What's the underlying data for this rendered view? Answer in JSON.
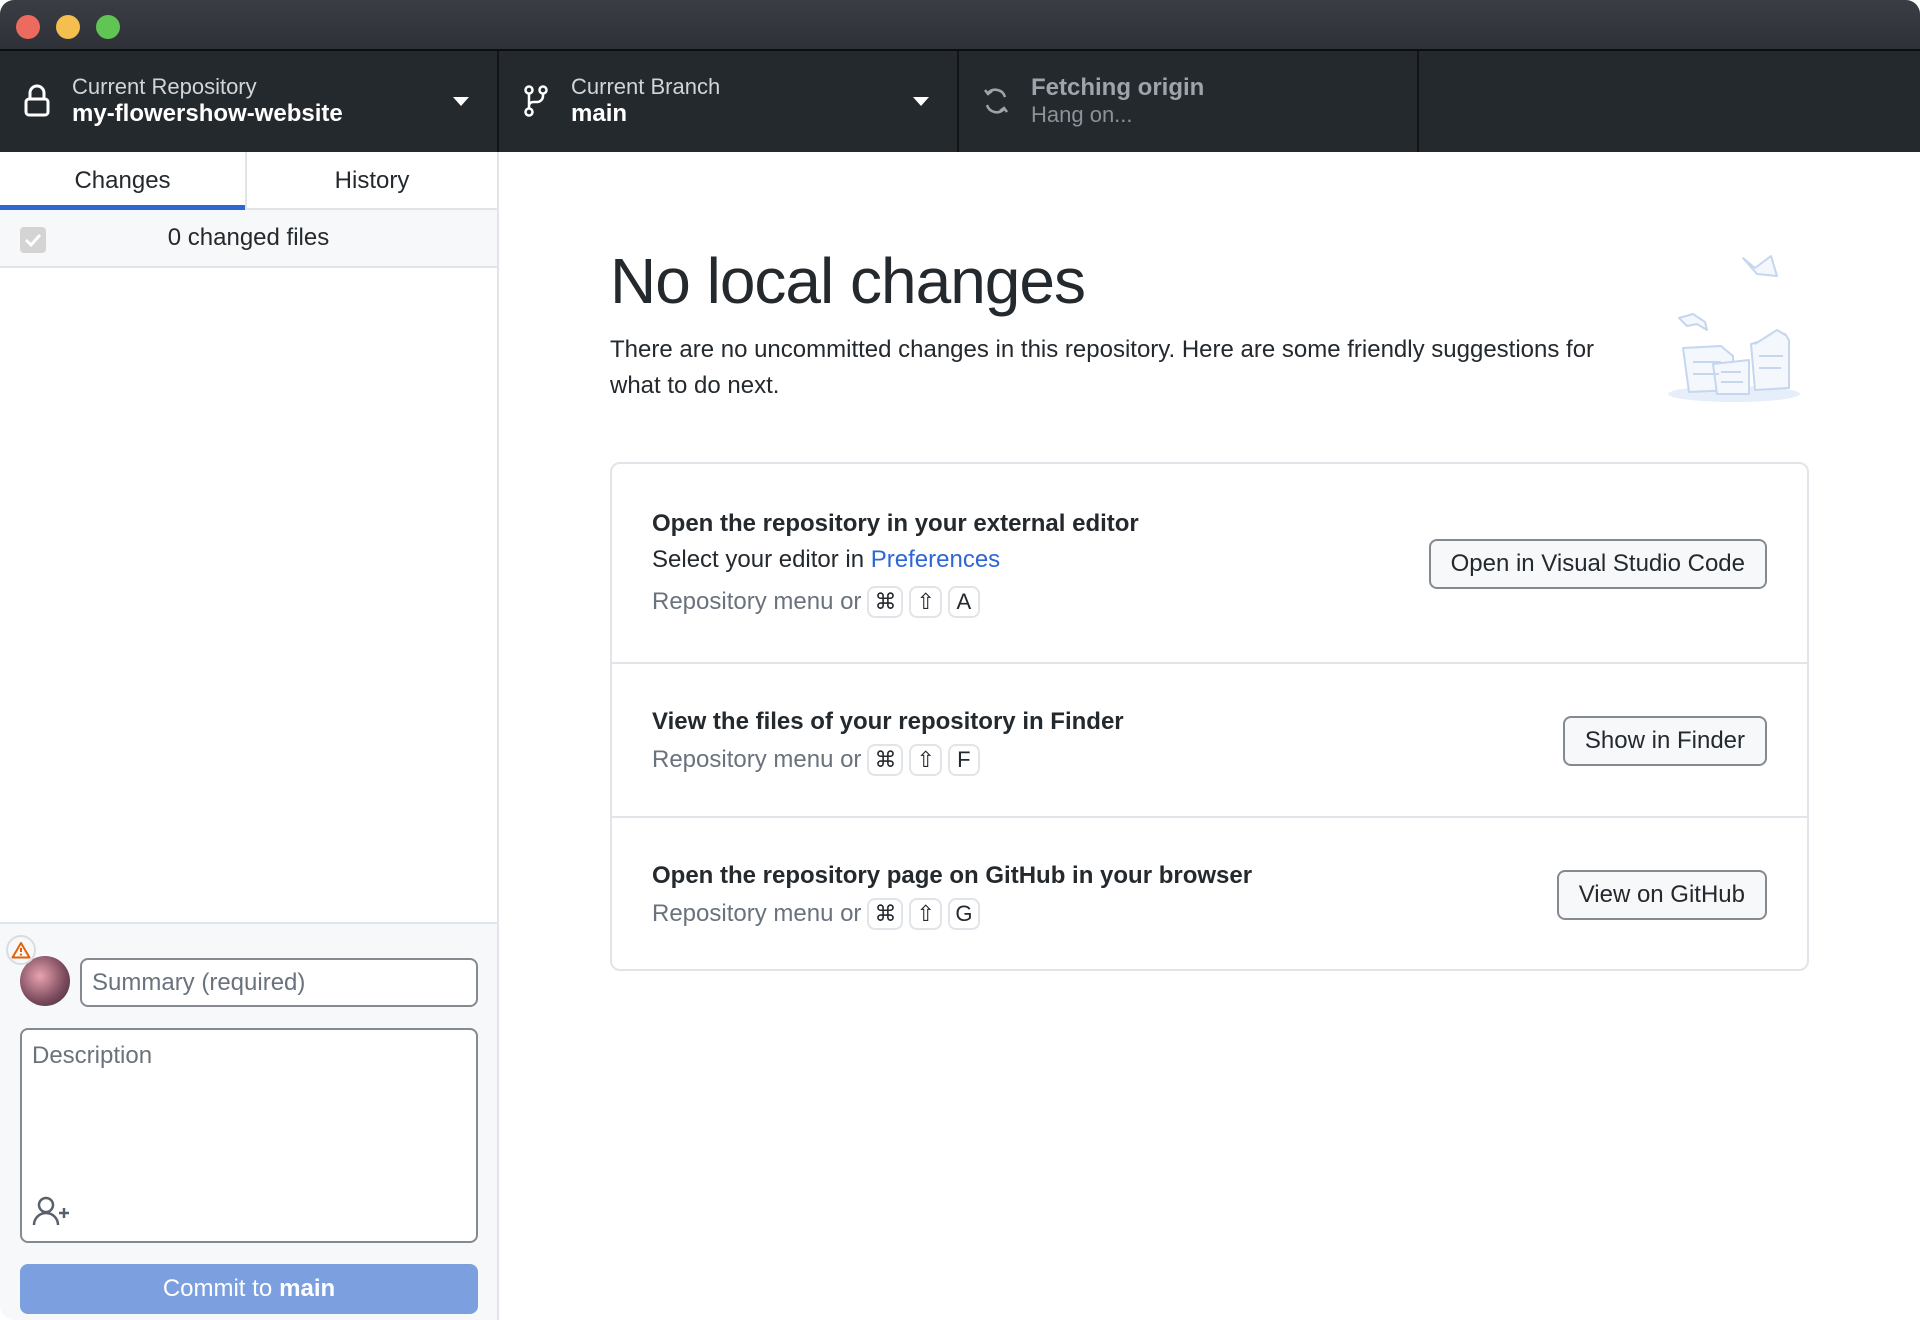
{
  "window": {
    "controls": [
      "close",
      "minimize",
      "maximize"
    ]
  },
  "toolbar": {
    "repository": {
      "label": "Current Repository",
      "value": "my-flowershow-website",
      "icon": "lock-icon"
    },
    "branch": {
      "label": "Current Branch",
      "value": "main",
      "icon": "git-branch-icon"
    },
    "fetch": {
      "label": "Fetching origin",
      "status": "Hang on...",
      "icon": "sync-icon"
    }
  },
  "sidebar": {
    "tabs": [
      {
        "label": "Changes",
        "active": true
      },
      {
        "label": "History",
        "active": false
      }
    ],
    "changed_files": "0 changed files",
    "select_all_checked": true
  },
  "commit": {
    "summary_placeholder": "Summary (required)",
    "summary_value": "",
    "description_placeholder": "Description",
    "description_value": "",
    "button_prefix": "Commit to",
    "button_branch": "main",
    "warning_icon": "alert-icon",
    "coauthor_icon": "person-add-icon",
    "button_color": "#7c9fdf"
  },
  "main": {
    "title": "No local changes",
    "description": "There are no uncommitted changes in this repository. Here are some friendly suggestions for what to do next.",
    "suggestions": [
      {
        "title": "Open the repository in your external editor",
        "line_prefix": "Select your editor in ",
        "line_link": "Preferences",
        "shortcut_prefix": "Repository menu or",
        "keys": [
          "⌘",
          "⇧",
          "A"
        ],
        "button": "Open in Visual Studio Code"
      },
      {
        "title": "View the files of your repository in Finder",
        "shortcut_prefix": "Repository menu or",
        "keys": [
          "⌘",
          "⇧",
          "F"
        ],
        "button": "Show in Finder"
      },
      {
        "title": "Open the repository page on GitHub in your browser",
        "shortcut_prefix": "Repository menu or",
        "keys": [
          "⌘",
          "⇧",
          "G"
        ],
        "button": "View on GitHub"
      }
    ]
  },
  "colors": {
    "accent": "#2e67d3",
    "toolbar_bg": "#24292e",
    "warning": "#e36209"
  }
}
